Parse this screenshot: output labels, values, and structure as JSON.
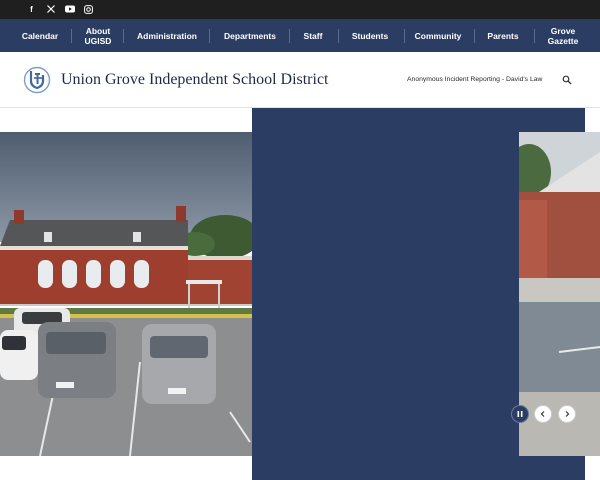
{
  "social": [
    {
      "name": "facebook-icon",
      "glyph": "f"
    },
    {
      "name": "x-icon",
      "glyph": "𝕏"
    },
    {
      "name": "youtube-icon",
      "glyph": "▶"
    },
    {
      "name": "instagram-icon",
      "glyph": "◎"
    }
  ],
  "nav": {
    "items": [
      {
        "label": "Calendar",
        "name": "nav-calendar"
      },
      {
        "label": "About UGISD",
        "name": "nav-about"
      },
      {
        "label": "Administration",
        "name": "nav-administration"
      },
      {
        "label": "Departments",
        "name": "nav-departments"
      },
      {
        "label": "Staff",
        "name": "nav-staff"
      },
      {
        "label": "Students",
        "name": "nav-students"
      },
      {
        "label": "Community",
        "name": "nav-community"
      },
      {
        "label": "Parents",
        "name": "nav-parents"
      },
      {
        "label": "Grove Gazette",
        "name": "nav-gazette"
      }
    ]
  },
  "header": {
    "title": "Union Grove Independent School District",
    "report_link": "Anonymous Incident Reporting - David's Law"
  },
  "slideshow": {
    "controls": [
      "pause-icon",
      "chevron-left-icon",
      "chevron-right-icon"
    ]
  },
  "colors": {
    "navy": "#2c3d63",
    "topbar": "#1f1f1f",
    "brick": "#9e3e2f"
  }
}
